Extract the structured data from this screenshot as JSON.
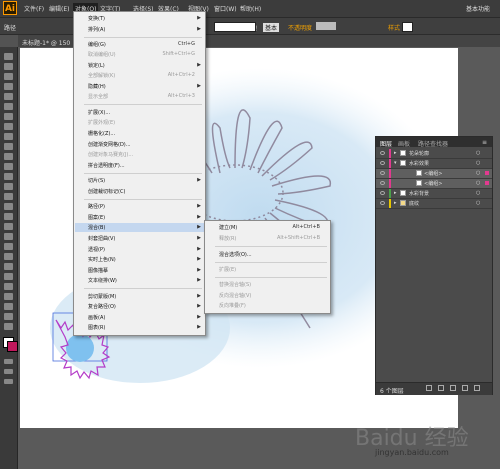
{
  "app": {
    "logo": "Ai",
    "workspace": "基本功能"
  },
  "menubar": {
    "items": [
      "文件(F)",
      "编辑(E)",
      "对象(O)",
      "文字(T)",
      "选择(S)",
      "效果(C)",
      "视图(V)",
      "窗口(W)",
      "帮助(H)"
    ],
    "active_index": 2
  },
  "controlbar": {
    "path_label": "路径",
    "stroke_label": "描边",
    "stroke_style": "基本",
    "opacity_label": "不透明度",
    "style_label": "样式"
  },
  "document": {
    "tab": "未标题-1* @ 150"
  },
  "object_menu": {
    "items": [
      {
        "label": "变换(T)",
        "arrow": true
      },
      {
        "label": "排列(A)",
        "arrow": true
      },
      {
        "label": "编组(G)",
        "shortcut": "Ctrl+G"
      },
      {
        "label": "取消编组(U)",
        "shortcut": "Shift+Ctrl+G",
        "disabled": true
      },
      {
        "label": "锁定(L)",
        "arrow": true
      },
      {
        "label": "全部解锁(K)",
        "shortcut": "Alt+Ctrl+2",
        "disabled": true
      },
      {
        "label": "隐藏(H)",
        "arrow": true
      },
      {
        "label": "显示全部",
        "shortcut": "Alt+Ctrl+3",
        "disabled": true
      },
      {
        "label": "扩展(X)..."
      },
      {
        "label": "扩展外观(E)",
        "disabled": true
      },
      {
        "label": "栅格化(Z)..."
      },
      {
        "label": "创建渐变网格(D)..."
      },
      {
        "label": "创建对象马赛克(J)...",
        "disabled": true
      },
      {
        "label": "拼合透明度(F)..."
      },
      {
        "label": "切片(S)",
        "arrow": true
      },
      {
        "label": "创建裁切标记(C)"
      },
      {
        "label": "路径(P)",
        "arrow": true
      },
      {
        "label": "图案(E)",
        "arrow": true
      },
      {
        "label": "混合(B)",
        "arrow": true,
        "highlighted": true
      },
      {
        "label": "封套扭曲(V)",
        "arrow": true
      },
      {
        "label": "透视(P)",
        "arrow": true
      },
      {
        "label": "实时上色(N)",
        "arrow": true
      },
      {
        "label": "图像描摹",
        "arrow": true
      },
      {
        "label": "文本绕排(W)",
        "arrow": true
      },
      {
        "label": "剪切蒙版(M)",
        "arrow": true
      },
      {
        "label": "复合路径(O)",
        "arrow": true
      },
      {
        "label": "画板(A)",
        "arrow": true
      },
      {
        "label": "图表(R)",
        "arrow": true
      }
    ]
  },
  "blend_submenu": {
    "items": [
      {
        "label": "建立(M)",
        "shortcut": "Alt+Ctrl+B"
      },
      {
        "label": "释放(R)",
        "shortcut": "Alt+Shift+Ctrl+B",
        "disabled": true
      },
      {
        "label": "混合选项(O)..."
      },
      {
        "label": "扩展(E)",
        "disabled": true
      },
      {
        "label": "替换混合轴(S)",
        "disabled": true
      },
      {
        "label": "反向混合轴(V)",
        "disabled": true
      },
      {
        "label": "反向堆叠(F)",
        "disabled": true
      }
    ]
  },
  "layers_panel": {
    "tabs": [
      "图层",
      "画板",
      "路径查找器"
    ],
    "rows": [
      {
        "name": "花朵轮廓",
        "color": "#e23a8f"
      },
      {
        "name": "水彩效果",
        "color": "#e23a8f"
      },
      {
        "name": "<编组>",
        "color": "#e23a8f"
      },
      {
        "name": "<编组>",
        "color": "#e23a8f"
      },
      {
        "name": "水彩背景",
        "color": "#4aa04a"
      },
      {
        "name": "底纹",
        "color": "#e6c600"
      }
    ],
    "footer": "6 个图层"
  },
  "watermark": {
    "text": "Baidu 经验",
    "url": "jingyan.baidu.com"
  }
}
